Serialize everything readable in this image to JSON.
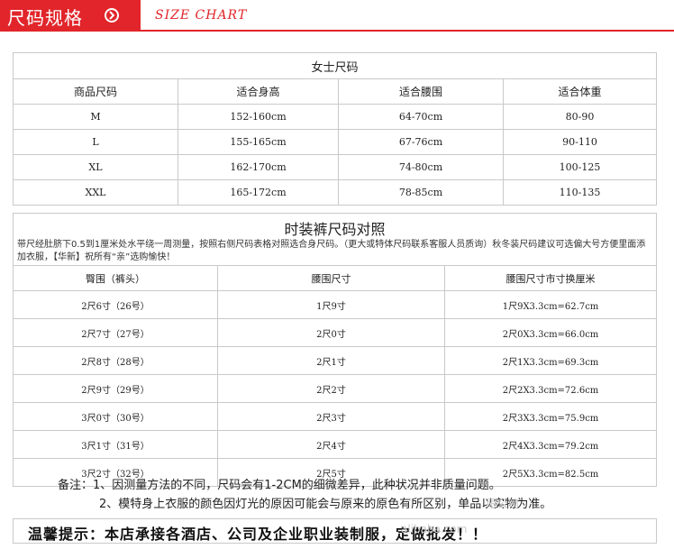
{
  "header": {
    "title": "尺码规格",
    "subtitle": "SIZE CHART",
    "accent_color": "#e1252a",
    "icon": "arrow-circle-icon"
  },
  "women_table": {
    "caption": "女士尺码",
    "headers": [
      "商品尺码",
      "适合身高",
      "适合腰围",
      "适合体重"
    ],
    "rows": [
      [
        "M",
        "152-160cm",
        "64-70cm",
        "80-90"
      ],
      [
        "L",
        "155-165cm",
        "67-76cm",
        "90-110"
      ],
      [
        "XL",
        "162-170cm",
        "74-80cm",
        "100-125"
      ],
      [
        "XXL",
        "165-172cm",
        "78-85cm",
        "110-135"
      ]
    ]
  },
  "pants_section": {
    "title": "时装裤尺码对照",
    "note": "带尺经肚脐下0.5到1厘米处水平绕一周测量，按照右侧尺码表格对照选合身尺码。（更大或特体尺码联系客服人员质询）秋冬装尺码建议可选偏大号方便里面添加衣服，【华新】祝所有“亲”选购愉快！"
  },
  "pants_table": {
    "headers": [
      "臀围（裤头）",
      "腰围尺寸",
      "腰围尺寸市寸换厘米"
    ],
    "rows": [
      [
        "2尺6寸（26号）",
        "1尺9寸",
        "1尺9X3.3cm=62.7cm"
      ],
      [
        "2尺7寸（27号）",
        "2尺0寸",
        "2尺0X3.3cm=66.0cm"
      ],
      [
        "2尺8寸（28号）",
        "2尺1寸",
        "2尺1X3.3cm=69.3cm"
      ],
      [
        "2尺9寸（29号）",
        "2尺2寸",
        "2尺2X3.3cm=72.6cm"
      ],
      [
        "3尺0寸（30号）",
        "2尺3寸",
        "2尺3X3.3cm=75.9cm"
      ],
      [
        "3尺1寸（31号）",
        "2尺4寸",
        "2尺4X3.3cm=79.2cm"
      ],
      [
        "3尺2寸（32号）",
        "2尺5寸",
        "2尺5X3.3cm=82.5cm"
      ]
    ]
  },
  "remarks": {
    "line1": "备注：1、因测量方法的不同，尺码会有1-2CM的细微差异，此种状况并非质量问题。",
    "line2": "2、模特身上衣服的颜色因灯光的原因可能会与原来的原色有所区别，单品以实物为准。"
  },
  "watermark": {
    "line1": "限公司",
    "line2": "alibaba.com"
  },
  "bottom_notice": "温馨提示：本店承接各酒店、公司及企业职业装制服，定做批发！！"
}
